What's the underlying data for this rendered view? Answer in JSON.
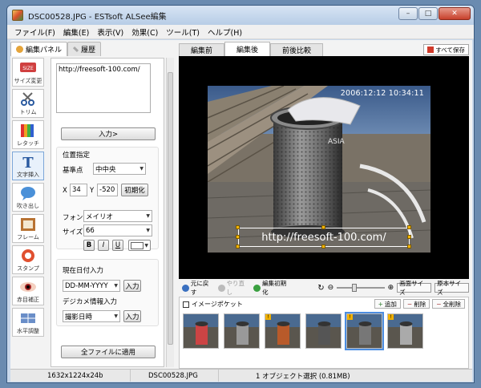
{
  "window": {
    "title": "DSC00528.JPG - ESTsoft ALSee編集",
    "min": "–",
    "max": "□",
    "close": "✕"
  },
  "menu": [
    "ファイル(F)",
    "編集(E)",
    "表示(V)",
    "効果(C)",
    "ツール(T)",
    "ヘルプ(H)"
  ],
  "left_tabs": {
    "edit_panel": "編集パネル",
    "history": "履歴"
  },
  "tools": [
    {
      "label": "サイズ変更",
      "icon": "resize-icon"
    },
    {
      "label": "トリム",
      "icon": "scissors-icon"
    },
    {
      "label": "レタッチ",
      "icon": "retouch-icon"
    },
    {
      "label": "文字挿入",
      "icon": "text-insert-icon"
    },
    {
      "label": "吹き出し",
      "icon": "speech-bubble-icon"
    },
    {
      "label": "フレーム",
      "icon": "frame-icon"
    },
    {
      "label": "スタンプ",
      "icon": "stamp-icon"
    },
    {
      "label": "赤目補正",
      "icon": "eye-icon"
    },
    {
      "label": "水平調整",
      "icon": "level-icon"
    }
  ],
  "settings": {
    "text_value": "http://freesoft-100.com/",
    "insert_button": "入力>",
    "position_title": "位置指定",
    "base_point_label": "基準点",
    "base_point_value": "中中央",
    "x_label": "X",
    "x_value": "34",
    "y_label": "Y",
    "y_value": "-520",
    "reset_position": "初期化",
    "font_label": "フォント",
    "font_value": "メイリオ",
    "size_label": "サイズ",
    "size_value": "66",
    "bold": "B",
    "italic": "I",
    "underline": "U",
    "date_title": "現在日付入力",
    "date_format": "DD-MM-YYYY",
    "date_insert": "入力",
    "exif_title": "デジカメ情報入力",
    "exif_value": "撮影日時",
    "exif_insert": "入力",
    "apply_all": "全ファイルに適用"
  },
  "right_tabs": {
    "before": "編集前",
    "after": "編集後",
    "compare": "前後比較",
    "save_all": "すべて保存"
  },
  "photo": {
    "datestamp": "2006:12:12  10:34:11",
    "watermark": "http://freesoft-100.com/",
    "bin_brand": "ASIA"
  },
  "controls": {
    "undo": "元に戻す",
    "redo": "やり直し",
    "reset": "編集初期化",
    "zoom_level": 0.35,
    "fit_screen": "画面サイズ",
    "original_size": "原本サイズ"
  },
  "pocket": {
    "title": "イメージポケット",
    "add": "追加",
    "remove": "削除",
    "clear": "全削除"
  },
  "thumbnails": [
    {
      "warn": false,
      "selected": false,
      "color": "#c44"
    },
    {
      "warn": false,
      "selected": false,
      "color": "#999"
    },
    {
      "warn": true,
      "selected": false,
      "color": "#b85a2a"
    },
    {
      "warn": false,
      "selected": false,
      "color": "#555"
    },
    {
      "warn": true,
      "selected": true,
      "color": "#777"
    },
    {
      "warn": true,
      "selected": false,
      "color": "#aaa"
    }
  ],
  "status": {
    "dimensions": "1632x1224x24b",
    "filename": "DSC00528.JPG",
    "selection": "1 オブジェクト選択 (0.81MB)"
  },
  "colors": {
    "accent": "#4c8de0",
    "handle": "#f7b500"
  }
}
